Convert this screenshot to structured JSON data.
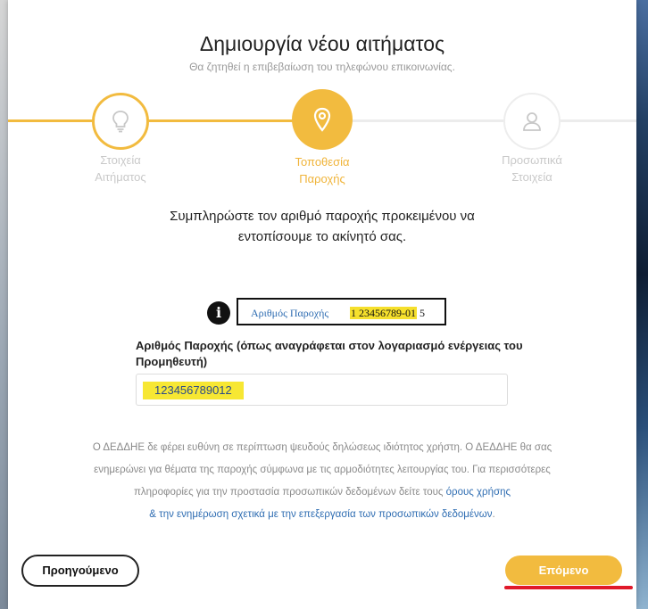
{
  "modal": {
    "title": "Δημιουργία νέου αιτήματος",
    "subtitle": "Θα ζητηθεί η επιβεβαίωση του τηλεφώνου επικοινωνίας."
  },
  "steps": [
    {
      "label_line1": "Στοιχεία",
      "label_line2": "Αιτήματος",
      "icon": "lightbulb-icon",
      "state": "completed"
    },
    {
      "label_line1": "Τοποθεσία",
      "label_line2": "Παροχής",
      "icon": "location-pin-icon",
      "state": "active"
    },
    {
      "label_line1": "Προσωπικά",
      "label_line2": "Στοιχεία",
      "icon": "user-icon",
      "state": "pending"
    }
  ],
  "instruction": "Συμπληρώστε τον αριθμό παροχής προκειμένου να εντοπίσουμε το ακίνητό σας.",
  "info_tooltip": {
    "label": "Αριθμός Παροχής",
    "number_highlighted": "1 23456789-01",
    "number_suffix": " 5"
  },
  "field": {
    "label": "Αριθμός Παροχής (όπως αναγράφεται στον λογαριασμό ενέργειας του Προμηθευτή)",
    "value": "123456789012"
  },
  "disclaimer": {
    "text": "Ο ΔΕΔΔΗΕ δε φέρει ευθύνη σε περίπτωση ψευδούς δηλώσεως ιδιότητος χρήστη. Ο ΔΕΔΔΗΕ θα σας ενημερώνει για θέματα της παροχής σύμφωνα με τις αρμοδιότητες λειτουργίας του. Για περισσότερες πληροφορίες για την προστασία προσωπικών δεδομένων δείτε τους ",
    "link1": "όρους χρήσης",
    "link2": "& την ενημέρωση σχετικά με την επεξεργασία των προσωπικών δεδομένων",
    "end": "."
  },
  "buttons": {
    "prev": "Προηγούμενο",
    "next": "Επόμενο"
  },
  "colors": {
    "accent": "#f2bb3f",
    "link": "#2f6db2",
    "highlight": "#f7e733",
    "annotation": "#e0192a"
  }
}
